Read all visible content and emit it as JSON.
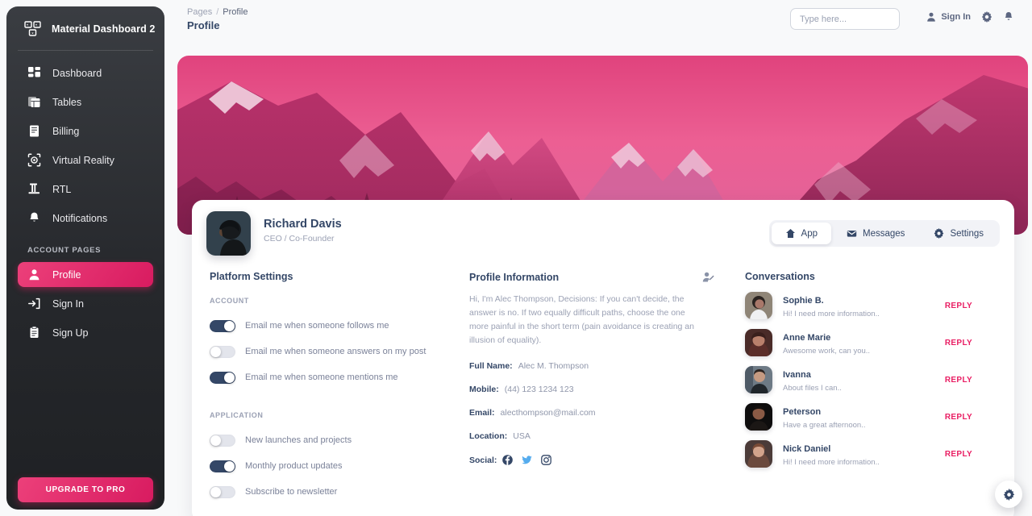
{
  "sidebar": {
    "brand": "Material Dashboard 2",
    "brand_icon": "dashboard-logo-icon",
    "items": [
      {
        "label": "Dashboard",
        "icon": "grid-icon",
        "active": false
      },
      {
        "label": "Tables",
        "icon": "table-icon",
        "active": false
      },
      {
        "label": "Billing",
        "icon": "receipt-icon",
        "active": false
      },
      {
        "label": "Virtual Reality",
        "icon": "vr-icon",
        "active": false
      },
      {
        "label": "RTL",
        "icon": "rtl-icon",
        "active": false
      },
      {
        "label": "Notifications",
        "icon": "bell-icon",
        "active": false
      }
    ],
    "section_label": "ACCOUNT PAGES",
    "account_items": [
      {
        "label": "Profile",
        "icon": "person-icon",
        "active": true
      },
      {
        "label": "Sign In",
        "icon": "login-icon",
        "active": false
      },
      {
        "label": "Sign Up",
        "icon": "clipboard-icon",
        "active": false
      }
    ],
    "upgrade_label": "UPGRADE TO PRO",
    "accent": "#e91e63"
  },
  "topbar": {
    "breadcrumb_root": "Pages",
    "breadcrumb_sep": "/",
    "breadcrumb_current": "Profile",
    "page_title": "Profile",
    "search_placeholder": "Type here...",
    "search_value": "",
    "signin_label": "Sign In",
    "signin_icon": "person-icon",
    "gear_icon": "gear-icon",
    "bell_icon": "bell-icon"
  },
  "profile": {
    "name": "Richard Davis",
    "role": "CEO / Co-Founder",
    "avatar_icon": "user-avatar",
    "tabs": [
      {
        "label": "App",
        "icon": "home-icon",
        "active": true
      },
      {
        "label": "Messages",
        "icon": "mail-icon",
        "active": false
      },
      {
        "label": "Settings",
        "icon": "gear-icon",
        "active": false
      }
    ]
  },
  "platform_settings": {
    "title": "Platform Settings",
    "groups": [
      {
        "heading": "ACCOUNT",
        "options": [
          {
            "label": "Email me when someone follows me",
            "on": true
          },
          {
            "label": "Email me when someone answers on my post",
            "on": false
          },
          {
            "label": "Email me when someone mentions me",
            "on": true
          }
        ]
      },
      {
        "heading": "APPLICATION",
        "options": [
          {
            "label": "New launches and projects",
            "on": false
          },
          {
            "label": "Monthly product updates",
            "on": true
          },
          {
            "label": "Subscribe to newsletter",
            "on": false
          }
        ]
      }
    ]
  },
  "profile_information": {
    "title": "Profile Information",
    "edit_icon": "edit-user-icon",
    "bio": "Hi, I'm Alec Thompson, Decisions: If you can't decide, the answer is no. If two equally difficult paths, choose the one more painful in the short term (pain avoidance is creating an illusion of equality).",
    "fields": [
      {
        "key": "Full Name:",
        "value": "Alec M. Thompson"
      },
      {
        "key": "Mobile:",
        "value": "(44) 123 1234 123"
      },
      {
        "key": "Email:",
        "value": "alecthompson@mail.com"
      },
      {
        "key": "Location:",
        "value": "USA"
      }
    ],
    "social_label": "Social:",
    "social": [
      {
        "name": "facebook-icon",
        "color": "#344767"
      },
      {
        "name": "twitter-icon",
        "color": "#55acee"
      },
      {
        "name": "instagram-icon",
        "color": "#344767"
      }
    ]
  },
  "conversations": {
    "title": "Conversations",
    "reply_label": "REPLY",
    "items": [
      {
        "name": "Sophie B.",
        "message": "Hi! I need more information..",
        "avatar": "avatar-sophie"
      },
      {
        "name": "Anne Marie",
        "message": "Awesome work, can you..",
        "avatar": "avatar-anne"
      },
      {
        "name": "Ivanna",
        "message": "About files I can..",
        "avatar": "avatar-ivanna"
      },
      {
        "name": "Peterson",
        "message": "Have a great afternoon..",
        "avatar": "avatar-peterson"
      },
      {
        "name": "Nick Daniel",
        "message": "Hi! I need more information..",
        "avatar": "avatar-nick"
      }
    ]
  },
  "fab": {
    "icon": "gear-icon"
  }
}
